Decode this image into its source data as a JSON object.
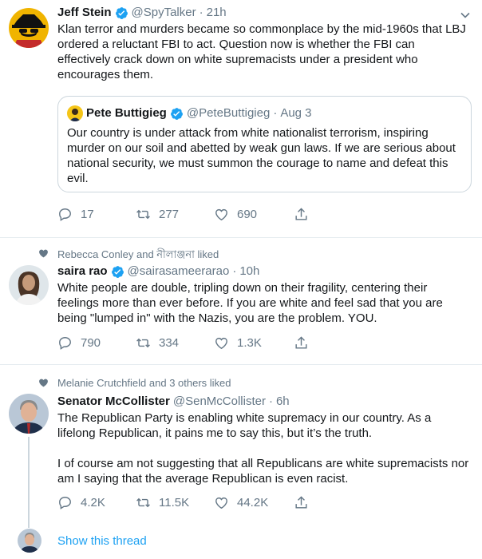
{
  "tweets": [
    {
      "name": "Jeff Stein",
      "handle": "@SpyTalker",
      "time": "21h",
      "text": "Klan terror and murders became so commonplace by the mid-1960s that LBJ ordered a reluctant FBI to act. Question now is whether the FBI can effectively crack down on white supremacists under a president who encourages them.",
      "quote": {
        "name": "Pete Buttigieg",
        "handle": "@PeteButtigieg",
        "time": "Aug 3",
        "text": "Our country is under attack from white nationalist terrorism, inspiring murder on our soil and abetted by weak gun laws. If we are serious about national security, we must summon the courage to name and defeat this evil."
      },
      "replies": "17",
      "retweets": "277",
      "likes": "690"
    },
    {
      "social": "Rebecca Conley and নীলাঞ্জনা liked",
      "name": "saira rao",
      "handle": "@sairasameerarao",
      "time": "10h",
      "text": "White people are double, tripling down on their fragility, centering their feelings more than ever before. If you are white and feel sad that you are being \"lumped in\" with the Nazis, you are the problem. YOU.",
      "replies": "790",
      "retweets": "334",
      "likes": "1.3K"
    },
    {
      "social": "Melanie Crutchfield and 3 others liked",
      "name": "Senator McCollister",
      "handle": "@SenMcCollister",
      "time": "6h",
      "text_p1": "The Republican Party is enabling white supremacy in our country.  As a lifelong Republican, it pains me to say this, but it’s the truth.",
      "text_p2": "I of course am not suggesting that all Republicans are white supremacists nor am I saying that the average Republican is even racist.",
      "replies": "4.2K",
      "retweets": "11.5K",
      "likes": "44.2K"
    }
  ],
  "show_thread": "Show this thread",
  "colors": {
    "accent": "#1da1f2",
    "secondary_text": "#657786",
    "border": "#e6ecf0",
    "quote_border": "#ccd6dd"
  },
  "icons": [
    "reply-icon",
    "retweet-icon",
    "like-icon",
    "share-icon",
    "verified-icon",
    "caret-down-icon",
    "heart-small-icon"
  ]
}
